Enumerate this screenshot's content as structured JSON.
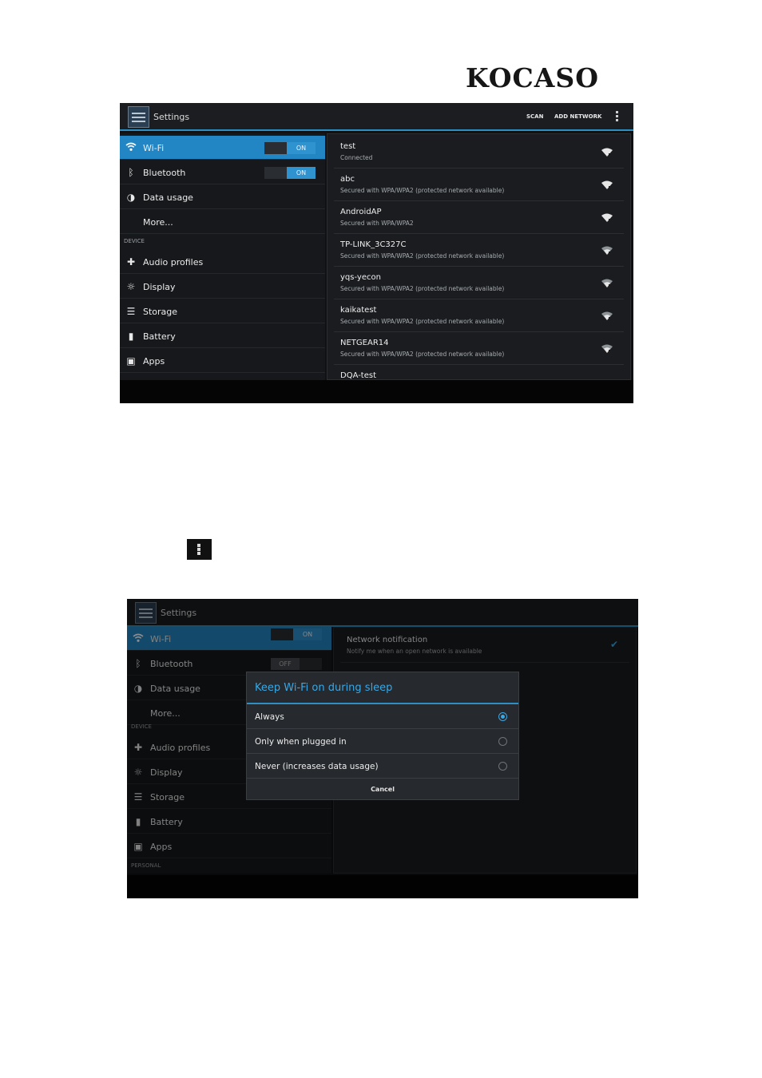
{
  "brand": {
    "logo_text": "KOCASO"
  },
  "screen1": {
    "actionbar": {
      "title": "Settings",
      "scan_label": "SCAN",
      "add_network_label": "ADD NETWORK"
    },
    "nav": [
      {
        "label": "Wi-Fi",
        "icon": "wifi-icon",
        "toggle": "ON"
      },
      {
        "label": "Bluetooth",
        "icon": "bluetooth-icon",
        "toggle": "ON"
      },
      {
        "label": "Data usage",
        "icon": "data-usage-icon"
      },
      {
        "label": "More..."
      }
    ],
    "device_header": "DEVICE",
    "device_nav": [
      {
        "label": "Audio profiles",
        "icon": "audio-profiles-icon"
      },
      {
        "label": "Display",
        "icon": "display-icon"
      },
      {
        "label": "Storage",
        "icon": "storage-icon"
      },
      {
        "label": "Battery",
        "icon": "battery-icon"
      },
      {
        "label": "Apps",
        "icon": "apps-icon"
      }
    ],
    "networks": [
      {
        "name": "test",
        "status": "Connected"
      },
      {
        "name": "abc",
        "status": "Secured with WPA/WPA2 (protected network available)"
      },
      {
        "name": "AndroidAP",
        "status": "Secured with WPA/WPA2"
      },
      {
        "name": "TP-LINK_3C327C",
        "status": "Secured with WPA/WPA2 (protected network available)"
      },
      {
        "name": "yqs-yecon",
        "status": "Secured with WPA/WPA2 (protected network available)"
      },
      {
        "name": "kaikatest",
        "status": "Secured with WPA/WPA2 (protected network available)"
      },
      {
        "name": "NETGEAR14",
        "status": "Secured with WPA/WPA2 (protected network available)"
      },
      {
        "name": "DQA-test",
        "status": ""
      }
    ]
  },
  "screen2": {
    "actionbar": {
      "title": "Settings"
    },
    "nav": [
      {
        "label": "Wi-Fi",
        "icon": "wifi-icon",
        "toggle": "ON"
      },
      {
        "label": "Bluetooth",
        "icon": "bluetooth-icon",
        "toggle": "OFF"
      },
      {
        "label": "Data usage",
        "icon": "data-usage-icon"
      },
      {
        "label": "More..."
      }
    ],
    "device_header": "DEVICE",
    "device_nav": [
      {
        "label": "Audio profiles",
        "icon": "audio-profiles-icon"
      },
      {
        "label": "Display",
        "icon": "display-icon"
      },
      {
        "label": "Storage",
        "icon": "storage-icon"
      },
      {
        "label": "Battery",
        "icon": "battery-icon"
      },
      {
        "label": "Apps",
        "icon": "apps-icon"
      }
    ],
    "personal_header": "PERSONAL",
    "setting": {
      "title": "Network notification",
      "summary": "Notify me when an open network is available"
    },
    "dialog": {
      "title": "Keep Wi-Fi on during sleep",
      "options": [
        {
          "label": "Always",
          "selected": true
        },
        {
          "label": "Only when plugged in",
          "selected": false
        },
        {
          "label": "Never (increases data usage)",
          "selected": false
        }
      ],
      "cancel_label": "Cancel"
    }
  },
  "colors": {
    "accent": "#2e8fc4",
    "active_item": "#2386c4",
    "dialog_title": "#38a8e6"
  }
}
